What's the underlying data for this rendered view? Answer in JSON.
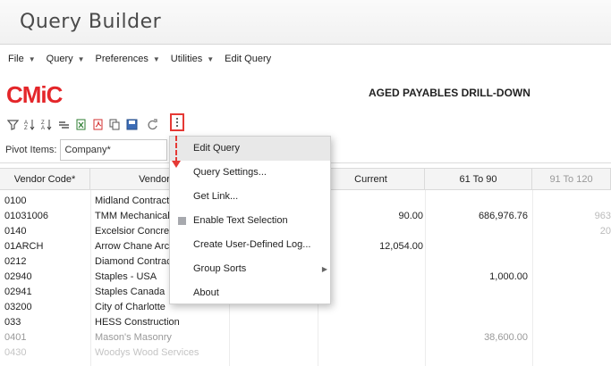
{
  "app": {
    "title": "Query Builder"
  },
  "menubar": [
    {
      "label": "File"
    },
    {
      "label": "Query"
    },
    {
      "label": "Preferences"
    },
    {
      "label": "Utilities"
    },
    {
      "label": "Edit Query"
    }
  ],
  "logo": {
    "text": "CMiC"
  },
  "report": {
    "title": "AGED PAYABLES DRILL-DOWN"
  },
  "toolbar": {
    "icons": [
      "filter-icon",
      "sort-ascending-icon",
      "sort-descending-icon",
      "group-icon",
      "excel-export-icon",
      "pdf-export-icon",
      "copy-icon",
      "save-layout-icon",
      "refresh-icon",
      "more-options-icon"
    ]
  },
  "pivot": {
    "label": "Pivot Items:",
    "value": "Company*"
  },
  "grid": {
    "headers": [
      "Vendor Code*",
      "Vendor N",
      "",
      "Current",
      "61 To 90",
      "91 To 120"
    ],
    "rows": [
      {
        "code": "0100",
        "name": "Midland Contract",
        "current": "",
        "d61": "",
        "d91": ""
      },
      {
        "code": "01031006",
        "name": "TMM Mechanical",
        "current": "90.00",
        "d61": "686,976.76",
        "d91": "963"
      },
      {
        "code": "0140",
        "name": "Excelsior Concrete",
        "current": "",
        "d61": "",
        "d91": "20"
      },
      {
        "code": "01ARCH",
        "name": "Arrow Chane Arch",
        "current": "12,054.00",
        "d61": "",
        "d91": ""
      },
      {
        "code": "0212",
        "name": "Diamond Contract",
        "current": "",
        "d61": "",
        "d91": ""
      },
      {
        "code": "02940",
        "name": "Staples - USA",
        "current": "",
        "d61": "1,000.00",
        "d91": ""
      },
      {
        "code": "02941",
        "name": "Staples Canada",
        "current": "",
        "d61": "",
        "d91": ""
      },
      {
        "code": "03200",
        "name": "City of Charlotte",
        "current": "",
        "d61": "",
        "d91": ""
      },
      {
        "code": "033",
        "name": "HESS Construction",
        "current": "",
        "d61": "",
        "d91": ""
      },
      {
        "code": "0401",
        "name": "Mason's Masonry",
        "current": "",
        "d61": "38,600.00",
        "d91": ""
      },
      {
        "code": "0430",
        "name": "Woodys Wood Services",
        "current": "",
        "d61": "",
        "d91": ""
      }
    ]
  },
  "dropdown": {
    "items": [
      {
        "label": "Edit Query"
      },
      {
        "label": "Query Settings..."
      },
      {
        "label": "Get Link..."
      },
      {
        "label": "Enable Text Selection"
      },
      {
        "label": "Create User-Defined Log..."
      },
      {
        "label": "Group Sorts"
      },
      {
        "label": "About"
      }
    ]
  },
  "colors": {
    "accent_red": "#e53935",
    "logo_red": "#e4262a",
    "header_bg": "#f4f4f4"
  }
}
